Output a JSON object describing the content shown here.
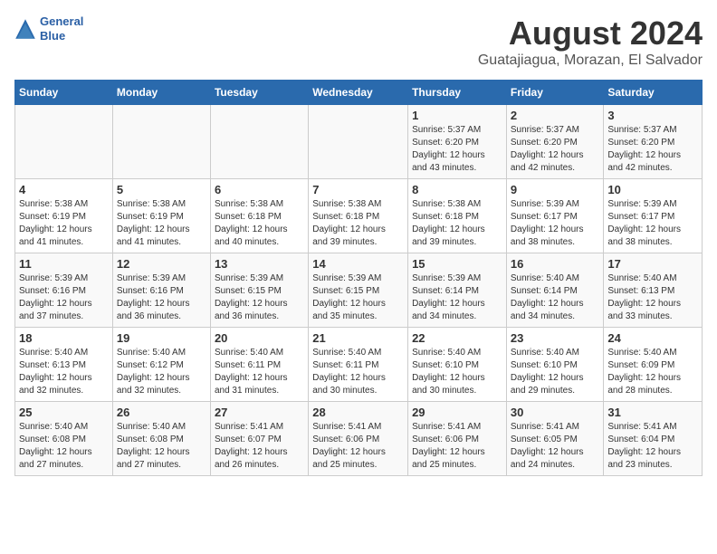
{
  "header": {
    "logo_line1": "General",
    "logo_line2": "Blue",
    "title": "August 2024",
    "subtitle": "Guatajiagua, Morazan, El Salvador"
  },
  "weekdays": [
    "Sunday",
    "Monday",
    "Tuesday",
    "Wednesday",
    "Thursday",
    "Friday",
    "Saturday"
  ],
  "weeks": [
    [
      {
        "day": "",
        "info": ""
      },
      {
        "day": "",
        "info": ""
      },
      {
        "day": "",
        "info": ""
      },
      {
        "day": "",
        "info": ""
      },
      {
        "day": "1",
        "info": "Sunrise: 5:37 AM\nSunset: 6:20 PM\nDaylight: 12 hours\nand 43 minutes."
      },
      {
        "day": "2",
        "info": "Sunrise: 5:37 AM\nSunset: 6:20 PM\nDaylight: 12 hours\nand 42 minutes."
      },
      {
        "day": "3",
        "info": "Sunrise: 5:37 AM\nSunset: 6:20 PM\nDaylight: 12 hours\nand 42 minutes."
      }
    ],
    [
      {
        "day": "4",
        "info": "Sunrise: 5:38 AM\nSunset: 6:19 PM\nDaylight: 12 hours\nand 41 minutes."
      },
      {
        "day": "5",
        "info": "Sunrise: 5:38 AM\nSunset: 6:19 PM\nDaylight: 12 hours\nand 41 minutes."
      },
      {
        "day": "6",
        "info": "Sunrise: 5:38 AM\nSunset: 6:18 PM\nDaylight: 12 hours\nand 40 minutes."
      },
      {
        "day": "7",
        "info": "Sunrise: 5:38 AM\nSunset: 6:18 PM\nDaylight: 12 hours\nand 39 minutes."
      },
      {
        "day": "8",
        "info": "Sunrise: 5:38 AM\nSunset: 6:18 PM\nDaylight: 12 hours\nand 39 minutes."
      },
      {
        "day": "9",
        "info": "Sunrise: 5:39 AM\nSunset: 6:17 PM\nDaylight: 12 hours\nand 38 minutes."
      },
      {
        "day": "10",
        "info": "Sunrise: 5:39 AM\nSunset: 6:17 PM\nDaylight: 12 hours\nand 38 minutes."
      }
    ],
    [
      {
        "day": "11",
        "info": "Sunrise: 5:39 AM\nSunset: 6:16 PM\nDaylight: 12 hours\nand 37 minutes."
      },
      {
        "day": "12",
        "info": "Sunrise: 5:39 AM\nSunset: 6:16 PM\nDaylight: 12 hours\nand 36 minutes."
      },
      {
        "day": "13",
        "info": "Sunrise: 5:39 AM\nSunset: 6:15 PM\nDaylight: 12 hours\nand 36 minutes."
      },
      {
        "day": "14",
        "info": "Sunrise: 5:39 AM\nSunset: 6:15 PM\nDaylight: 12 hours\nand 35 minutes."
      },
      {
        "day": "15",
        "info": "Sunrise: 5:39 AM\nSunset: 6:14 PM\nDaylight: 12 hours\nand 34 minutes."
      },
      {
        "day": "16",
        "info": "Sunrise: 5:40 AM\nSunset: 6:14 PM\nDaylight: 12 hours\nand 34 minutes."
      },
      {
        "day": "17",
        "info": "Sunrise: 5:40 AM\nSunset: 6:13 PM\nDaylight: 12 hours\nand 33 minutes."
      }
    ],
    [
      {
        "day": "18",
        "info": "Sunrise: 5:40 AM\nSunset: 6:13 PM\nDaylight: 12 hours\nand 32 minutes."
      },
      {
        "day": "19",
        "info": "Sunrise: 5:40 AM\nSunset: 6:12 PM\nDaylight: 12 hours\nand 32 minutes."
      },
      {
        "day": "20",
        "info": "Sunrise: 5:40 AM\nSunset: 6:11 PM\nDaylight: 12 hours\nand 31 minutes."
      },
      {
        "day": "21",
        "info": "Sunrise: 5:40 AM\nSunset: 6:11 PM\nDaylight: 12 hours\nand 30 minutes."
      },
      {
        "day": "22",
        "info": "Sunrise: 5:40 AM\nSunset: 6:10 PM\nDaylight: 12 hours\nand 30 minutes."
      },
      {
        "day": "23",
        "info": "Sunrise: 5:40 AM\nSunset: 6:10 PM\nDaylight: 12 hours\nand 29 minutes."
      },
      {
        "day": "24",
        "info": "Sunrise: 5:40 AM\nSunset: 6:09 PM\nDaylight: 12 hours\nand 28 minutes."
      }
    ],
    [
      {
        "day": "25",
        "info": "Sunrise: 5:40 AM\nSunset: 6:08 PM\nDaylight: 12 hours\nand 27 minutes."
      },
      {
        "day": "26",
        "info": "Sunrise: 5:40 AM\nSunset: 6:08 PM\nDaylight: 12 hours\nand 27 minutes."
      },
      {
        "day": "27",
        "info": "Sunrise: 5:41 AM\nSunset: 6:07 PM\nDaylight: 12 hours\nand 26 minutes."
      },
      {
        "day": "28",
        "info": "Sunrise: 5:41 AM\nSunset: 6:06 PM\nDaylight: 12 hours\nand 25 minutes."
      },
      {
        "day": "29",
        "info": "Sunrise: 5:41 AM\nSunset: 6:06 PM\nDaylight: 12 hours\nand 25 minutes."
      },
      {
        "day": "30",
        "info": "Sunrise: 5:41 AM\nSunset: 6:05 PM\nDaylight: 12 hours\nand 24 minutes."
      },
      {
        "day": "31",
        "info": "Sunrise: 5:41 AM\nSunset: 6:04 PM\nDaylight: 12 hours\nand 23 minutes."
      }
    ]
  ]
}
